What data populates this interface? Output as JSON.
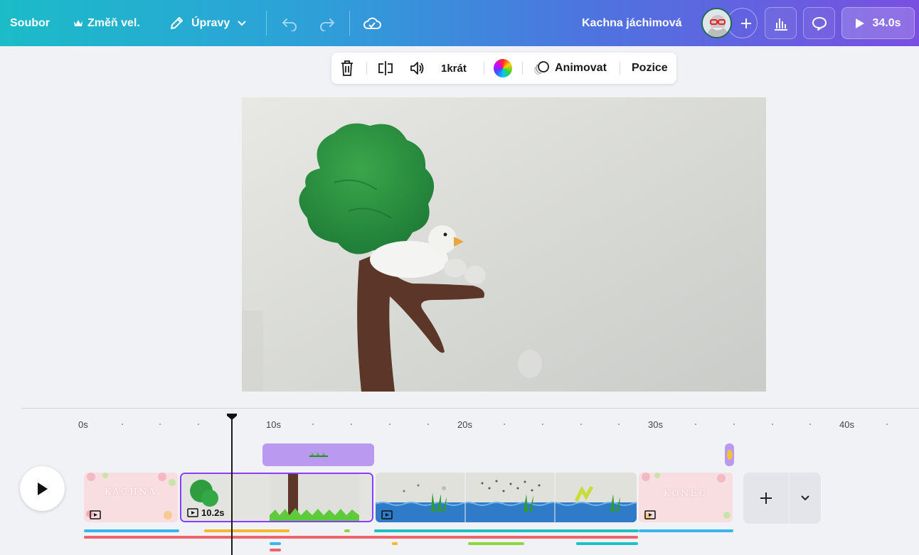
{
  "topbar": {
    "file_label": "Soubor",
    "resize_label": "Změň vel.",
    "edit_label": "Úpravy",
    "project_title": "Kachna jáchimová",
    "duration_label": "34.0s"
  },
  "context_toolbar": {
    "speed_label": "1krát",
    "animate_label": "Animovat",
    "position_label": "Pozice"
  },
  "timeline": {
    "ticks": [
      "0s",
      "10s",
      "20s",
      "30s",
      "40s"
    ],
    "current_clip_duration": "10.2s"
  },
  "clips": [
    {
      "text": "KACHNA"
    },
    {
      "text": ""
    },
    {
      "text": ""
    },
    {
      "text": "KONEC"
    }
  ],
  "colors": {
    "accent": "#8b3dff",
    "audio": "#b99af0",
    "lane_blue": "#3bb5ef",
    "lane_red": "#f0636b",
    "lane_yellow": "#f5b82e",
    "lane_green": "#8ed640",
    "lane_teal": "#1fc1c2"
  }
}
